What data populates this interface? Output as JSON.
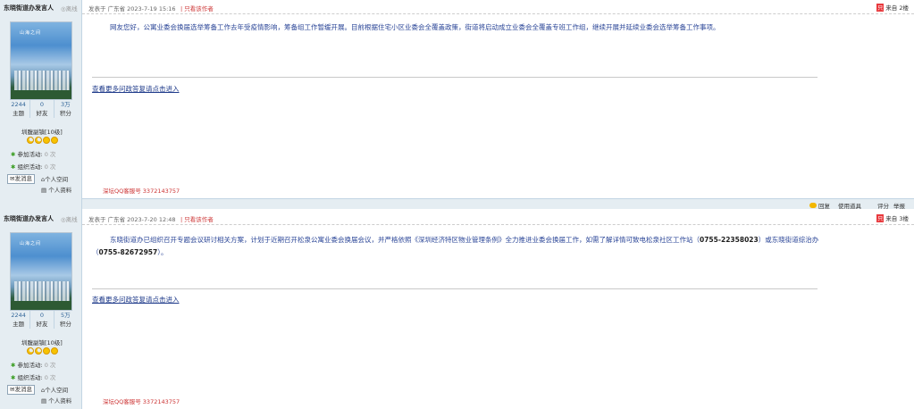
{
  "posts": [
    {
      "author": "东晓街道办发言人",
      "status": "离线",
      "avatar_text": "山海之间",
      "stats": [
        {
          "num": "2244",
          "label": "主题"
        },
        {
          "num": "0",
          "label": "好友"
        },
        {
          "num": "3万",
          "label": "积分"
        }
      ],
      "rank": "圳腹副镇[10级]",
      "activity_join": "参加活动:",
      "activity_join_count": "0 次",
      "activity_org": "组织活动:",
      "activity_org_count": "0 次",
      "msg_button": "发消息",
      "space_link": "个人空间",
      "profile_link": "个人资料",
      "time": "发表于 广东省 2023-7-19 15:16",
      "only_author": "只看该作者",
      "hot_badge": "只",
      "floor": "来自 2楼",
      "content": "网友您好，公寓业委会换届选举筹备工作去年受疫情影响，筹备组工作暂缓开展。目前根据住宅小区业委会全覆盖政策，街道将启动成立业委会全覆盖专班工作组，继续开展并延续业委会选举筹备工作事项。",
      "more_link": "查看更多问政答复请点击进入",
      "qq": "深坛QQ客服号 3372143757",
      "toolbar": {
        "reply": "回复",
        "tools": "使用道具",
        "rate": "评分",
        "report": "举报"
      }
    },
    {
      "author": "东晓街道办发言人",
      "status": "离线",
      "avatar_text": "山海之间",
      "stats": [
        {
          "num": "2244",
          "label": "主题"
        },
        {
          "num": "0",
          "label": "好友"
        },
        {
          "num": "5万",
          "label": "积分"
        }
      ],
      "rank": "圳腹副镇[10级]",
      "activity_join": "参加活动:",
      "activity_join_count": "0 次",
      "activity_org": "组织活动:",
      "activity_org_count": "0 次",
      "msg_button": "发消息",
      "space_link": "个人空间",
      "profile_link": "个人资料",
      "time": "发表于 广东省 2023-7-20 12:48",
      "only_author": "只看该作者",
      "hot_badge": "只",
      "floor": "来自 3楼",
      "content_a": "东晓街道办已组织召开专题会议研讨相关方案，计划于近期召开松泉公寓业委会换届会议，并严格依照《深圳经济特区物业管理条例》全力推进业委会换届工作，如需了解详情可致电松泉社区工作站（",
      "phone1": "0755-22358023",
      "content_b": "）或东晓街道综治办（",
      "phone2": "0755-82672957",
      "content_c": "）。",
      "more_link": "查看更多问政答复请点击进入",
      "qq": "深坛QQ客服号 3372143757"
    }
  ]
}
